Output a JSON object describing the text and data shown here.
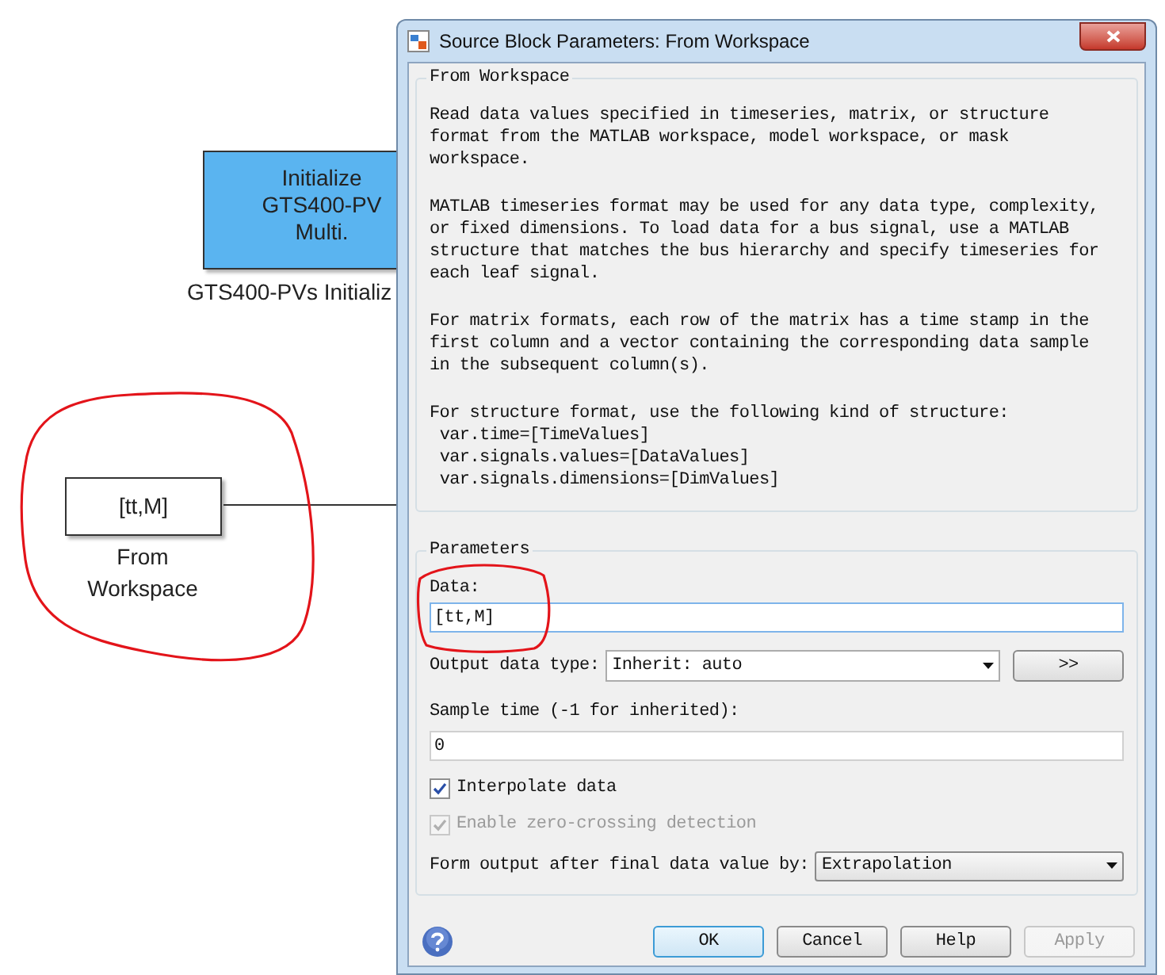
{
  "canvas": {
    "blocks": [
      {
        "kind": "subsystem",
        "text": "Initialize\nGTS400-PV\nMulti.",
        "label": "GTS400-PVs Initializ"
      },
      {
        "kind": "source",
        "text": "[tt,M]",
        "label": "From\nWorkspace"
      }
    ]
  },
  "dialog": {
    "title": "Source Block Parameters: From Workspace",
    "group_title": "From Workspace",
    "description": [
      "Read data values specified in timeseries, matrix, or structure\nformat from the MATLAB workspace, model workspace, or mask\nworkspace.",
      "MATLAB timeseries format may be used for any data type, complexity,\nor fixed dimensions. To load data for a bus signal, use a MATLAB\nstructure that matches the bus hierarchy and specify timeseries for\neach leaf signal.",
      "For matrix formats, each row of the matrix has a time stamp in the\nfirst column and a vector containing the corresponding data sample\nin the subsequent column(s).",
      "For structure format, use the following kind of structure:\n var.time=[TimeValues]\n var.signals.values=[DataValues]\n var.signals.dimensions=[DimValues]"
    ],
    "parameters_title": "Parameters",
    "data": {
      "label": "Data:",
      "value": "[tt,M]"
    },
    "output_data_type": {
      "label": "Output data type:",
      "value": "Inherit: auto",
      "button": ">>"
    },
    "sample_time": {
      "label": "Sample time (-1 for inherited):",
      "value": "0"
    },
    "checkboxes": [
      {
        "label": "Interpolate data",
        "checked": true,
        "disabled": false
      },
      {
        "label": "Enable zero-crossing detection",
        "checked": true,
        "disabled": true
      }
    ],
    "form_output": {
      "label": "Form output after final data value by:",
      "value": "Extrapolation"
    },
    "buttons": [
      {
        "label": "OK",
        "default": true,
        "disabled": false
      },
      {
        "label": "Cancel",
        "default": false,
        "disabled": false
      },
      {
        "label": "Help",
        "default": false,
        "disabled": false
      },
      {
        "label": "Apply",
        "default": false,
        "disabled": true
      }
    ]
  }
}
